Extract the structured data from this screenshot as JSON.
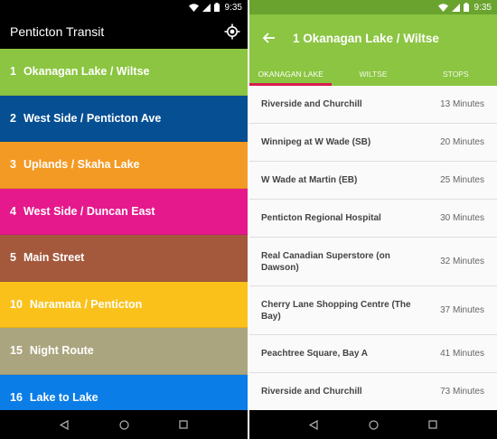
{
  "status": {
    "time": "9:35"
  },
  "left_app": {
    "title": "Penticton Transit",
    "routes": [
      {
        "number": "1",
        "name": "Okanagan Lake / Wiltse",
        "color": "#8bc541"
      },
      {
        "number": "2",
        "name": "West Side / Penticton Ave",
        "color": "#064f93"
      },
      {
        "number": "3",
        "name": "Uplands / Skaha Lake",
        "color": "#f39a24"
      },
      {
        "number": "4",
        "name": "West Side / Duncan East",
        "color": "#e5198c"
      },
      {
        "number": "5",
        "name": "Main Street",
        "color": "#a4593d"
      },
      {
        "number": "10",
        "name": "Naramata / Penticton",
        "color": "#fbc11b"
      },
      {
        "number": "15",
        "name": "Night Route",
        "color": "#aba57f"
      },
      {
        "number": "16",
        "name": "Lake to Lake",
        "color": "#0b7de6"
      }
    ]
  },
  "right_app": {
    "title": "1 Okanagan Lake / Wiltse",
    "tabs": [
      "OKANAGAN LAKE",
      "WILTSE",
      "STOPS"
    ],
    "active_tab": 0,
    "stops": [
      {
        "name": "Riverside and Churchill",
        "time": "13 Minutes"
      },
      {
        "name": "Winnipeg at W Wade (SB)",
        "time": "20 Minutes"
      },
      {
        "name": "W Wade at Martin (EB)",
        "time": "25 Minutes"
      },
      {
        "name": "Penticton Regional Hospital",
        "time": "30 Minutes"
      },
      {
        "name": "Real Canadian Superstore (on Dawson)",
        "time": "32 Minutes"
      },
      {
        "name": "Cherry Lane Shopping Centre (The Bay)",
        "time": "37 Minutes"
      },
      {
        "name": "Peachtree Square, Bay A",
        "time": "41 Minutes"
      },
      {
        "name": "Riverside and Churchill",
        "time": "73 Minutes"
      }
    ]
  },
  "icons": {
    "wifi": "wifi-icon",
    "signal": "signal-icon",
    "battery": "battery-icon",
    "locate": "my-location-icon",
    "back": "back-arrow-icon",
    "nav_back": "nav-back-icon",
    "nav_home": "nav-home-icon",
    "nav_recents": "nav-recents-icon"
  }
}
